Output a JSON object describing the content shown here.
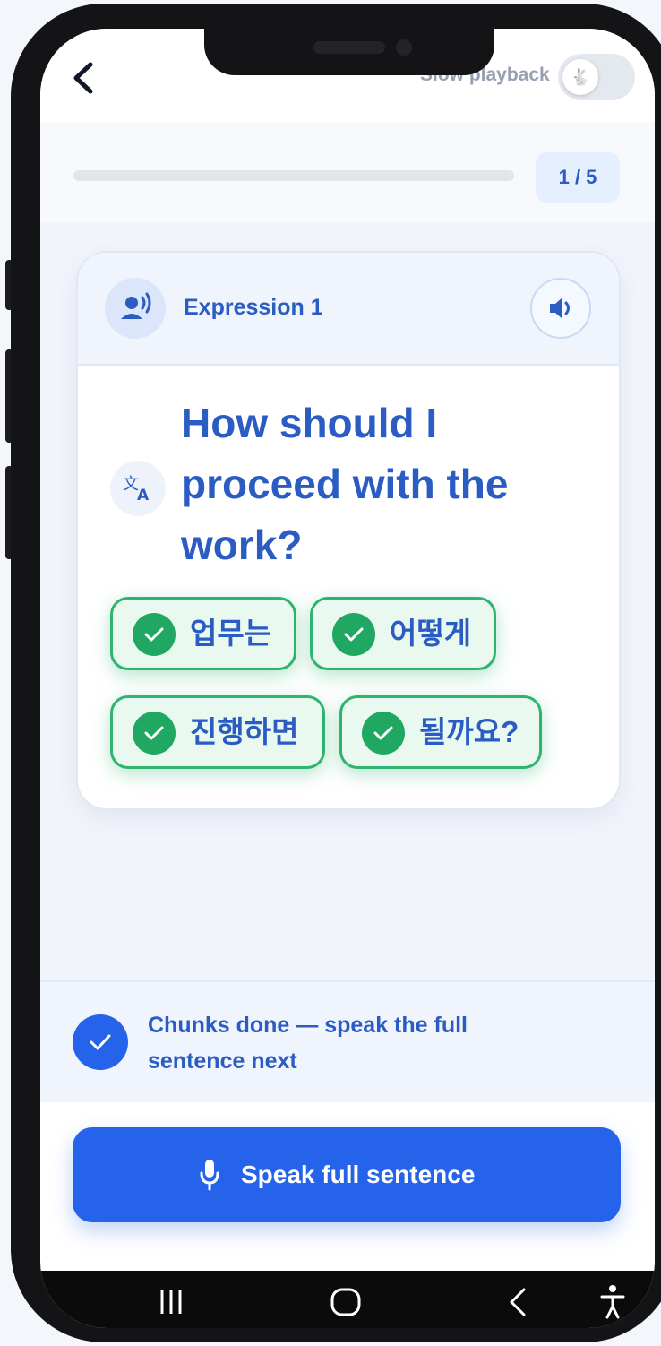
{
  "header": {
    "slow_playback_label": "Slow playback",
    "slow_playback_on": false,
    "toggle_icon": "rabbit-icon"
  },
  "progress": {
    "counter": "1 / 5",
    "fraction": 0.0
  },
  "card": {
    "label": "Expression 1",
    "sentence": "How should I proceed with the work?",
    "chunks": [
      {
        "text": "업무는",
        "done": true
      },
      {
        "text": "어떻게",
        "done": true
      },
      {
        "text": "진행하면",
        "done": true
      },
      {
        "text": "될까요?",
        "done": true
      }
    ]
  },
  "status": {
    "text": "Chunks done — speak the full sentence next"
  },
  "action": {
    "label": "Speak full sentence",
    "icon": "microphone-icon"
  },
  "colors": {
    "accent": "#2563eb",
    "text_accent": "#2a5cc4",
    "success": "#20a862"
  }
}
